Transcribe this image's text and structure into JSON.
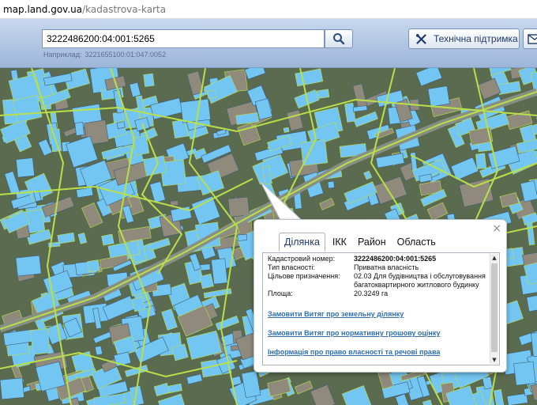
{
  "browser": {
    "url_domain": "map.land.gov.ua",
    "url_path": "/kadastrova-karta"
  },
  "header": {
    "search_value": "3222486200:04:001:5265",
    "hint_label": "Наприклад:",
    "hint_value": "3221655100:01:047:0052",
    "support_label": "Технічна підтримка",
    "search_icon": "search-icon",
    "support_icon": "tools-icon",
    "mail_icon": "mail-icon"
  },
  "map": {
    "base_color": "#5a6a4e",
    "parcel_color": "#74c6f2",
    "boundary_color": "#b9e04a"
  },
  "popup": {
    "tabs": [
      "Ділянка",
      "ІКК",
      "Район",
      "Область"
    ],
    "active_tab": "Ділянка",
    "fields": [
      {
        "key": "Кадастровий номер:",
        "value": "3222486200:04:001:5265"
      },
      {
        "key": "Тип власності:",
        "value": "Приватна власність"
      },
      {
        "key": "Цільове призначення:",
        "value": "02.03 Для будівництва і обслуговування багатоквартирного житлового будинку"
      },
      {
        "key": "Площа:",
        "value": "20.3249 га"
      }
    ],
    "links": [
      "Замовити Витяг про земельну ділянку",
      "Замовити Витяг про нормативну грошову оцінку",
      "Інформація про право власності та речові права"
    ],
    "close_symbol": "×"
  }
}
